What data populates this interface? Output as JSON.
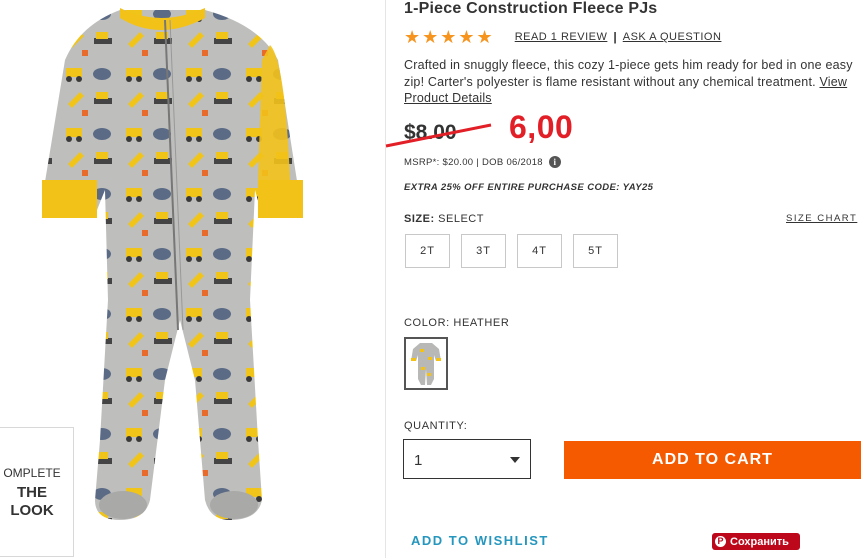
{
  "product": {
    "title": "1-Piece Construction Fleece PJs",
    "stars": "★★★★★",
    "rating": 5,
    "review_link": "READ 1 REVIEW",
    "separator": "|",
    "question_link": "ASK A QUESTION",
    "description": "Crafted in snuggly fleece, this cozy 1-piece gets him ready for bed in one easy zip! Carter's polyester is flame resistant without any chemical treatment. ",
    "details_link": "View Product Details",
    "old_price": "$8.00",
    "new_price": "6,00",
    "msrp": "MSRP*: $20.00 | DOB 06/2018",
    "promo": "EXTRA 25% OFF ENTIRE PURCHASE CODE: YAY25"
  },
  "size": {
    "label_prefix": "SIZE:",
    "label_value": " SELECT",
    "chart_link": "SIZE CHART",
    "options": [
      "2T",
      "3T",
      "4T",
      "5T"
    ]
  },
  "color": {
    "label": "COLOR: HEATHER",
    "swatch_icon": "pajama-swatch"
  },
  "quantity": {
    "label": "QUANTITY:",
    "value": "1"
  },
  "actions": {
    "add_to_cart": "ADD TO CART",
    "wishlist": "ADD TO WISHLIST",
    "pinterest_save": "Сохранить",
    "pinterest_icon": "P"
  },
  "complete_look": {
    "line1": "OMPLETE",
    "line2": "THE",
    "line3": "LOOK"
  },
  "colors": {
    "sale_red": "#e21f26",
    "cart_orange": "#f55a00",
    "star_orange": "#f7941d",
    "link_blue": "#2596be",
    "pinterest_red": "#bd081c",
    "fabric_gray": "#b8b8b6",
    "trim_yellow": "#f3c219"
  }
}
